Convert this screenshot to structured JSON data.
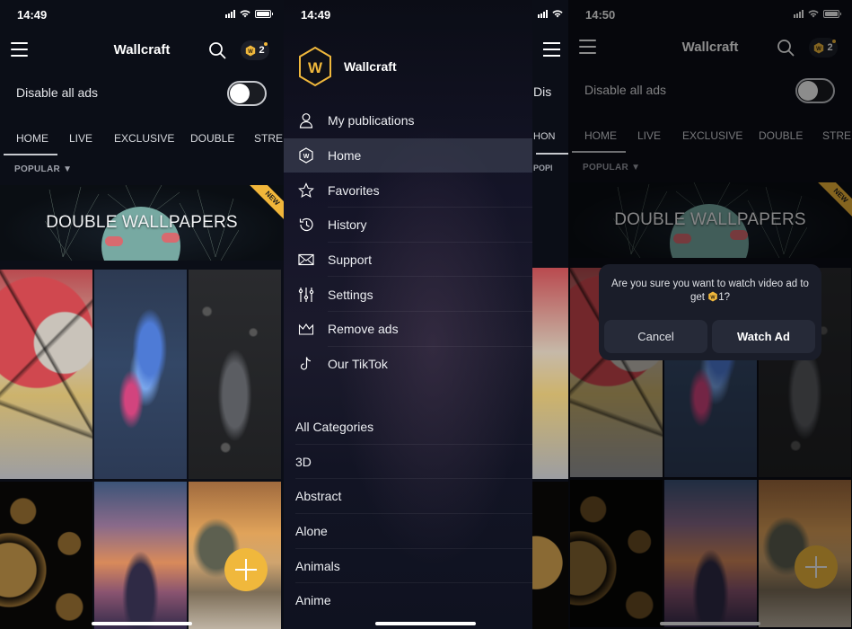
{
  "screens": [
    {
      "status": {
        "time": "14:49"
      },
      "header": {
        "title": "Wallcraft",
        "coins": "2"
      },
      "ads": {
        "label": "Disable all ads",
        "toggle_on": false
      },
      "tabs": [
        "HOME",
        "LIVE",
        "EXCLUSIVE",
        "DOUBLE",
        "STRE"
      ],
      "active_tab": "HOME",
      "sort": "POPULAR ▼",
      "banner": {
        "title": "DOUBLE WALLPAPERS",
        "badge": "NEW"
      }
    },
    {
      "status": {
        "time": "14:49"
      },
      "brand": {
        "name": "Wallcraft",
        "logo_letter": "W"
      },
      "menu": [
        {
          "label": "My publications",
          "icon": "user-icon"
        },
        {
          "label": "Home",
          "icon": "wallcraft-hex-icon",
          "active": true
        },
        {
          "label": "Favorites",
          "icon": "star-icon"
        },
        {
          "label": "History",
          "icon": "history-icon"
        },
        {
          "label": "Support",
          "icon": "envelope-icon"
        },
        {
          "label": "Settings",
          "icon": "sliders-icon"
        },
        {
          "label": "Remove ads",
          "icon": "crown-icon"
        },
        {
          "label": "Our TikTok",
          "icon": "tiktok-icon"
        }
      ],
      "categories": [
        "All Categories",
        "3D",
        "Abstract",
        "Alone",
        "Animals",
        "Anime"
      ],
      "peek": {
        "ads": "Dis",
        "tab": "HON",
        "sort": "POPI"
      }
    },
    {
      "status": {
        "time": "14:50"
      },
      "header": {
        "title": "Wallcraft",
        "coins": "2"
      },
      "ads": {
        "label": "Disable all ads",
        "toggle_on": false
      },
      "tabs": [
        "HOME",
        "LIVE",
        "EXCLUSIVE",
        "DOUBLE",
        "STRE"
      ],
      "sort": "POPULAR ▼",
      "banner": {
        "title": "DOUBLE WALLPAPERS",
        "badge": "NEW"
      },
      "dialog": {
        "message_pre": "Are you sure you want to watch video ad to get",
        "message_amount": "1?",
        "cancel": "Cancel",
        "confirm": "Watch Ad"
      }
    }
  ],
  "colors": {
    "accent": "#f0b83c",
    "background": "#0b0e17",
    "dialog": "#1a1d29"
  }
}
